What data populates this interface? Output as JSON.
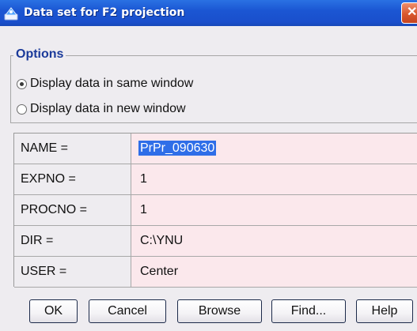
{
  "window": {
    "title": "Data set for F2 projection",
    "icon": "app-icon",
    "close_icon": "close-icon"
  },
  "options": {
    "legend": "Options",
    "radios": [
      {
        "label": "Display data in same window",
        "selected": true
      },
      {
        "label": "Display data in new window",
        "selected": false
      }
    ]
  },
  "params": [
    {
      "label": "NAME =",
      "value": "PrPr_090630",
      "selected_text": true
    },
    {
      "label": "EXPNO =",
      "value": "1",
      "selected_text": false
    },
    {
      "label": "PROCNO =",
      "value": "1",
      "selected_text": false
    },
    {
      "label": "DIR =",
      "value": "C:\\YNU",
      "selected_text": false
    },
    {
      "label": "USER =",
      "value": "Center",
      "selected_text": false
    }
  ],
  "buttons": {
    "ok": "OK",
    "cancel": "Cancel",
    "browse": "Browse",
    "find": "Find...",
    "help": "Help"
  },
  "colors": {
    "title_bar": "#1b56d3",
    "field_background": "#fbe8ec",
    "selection": "#2f6ee8",
    "legend_text": "#1b3a9a"
  }
}
